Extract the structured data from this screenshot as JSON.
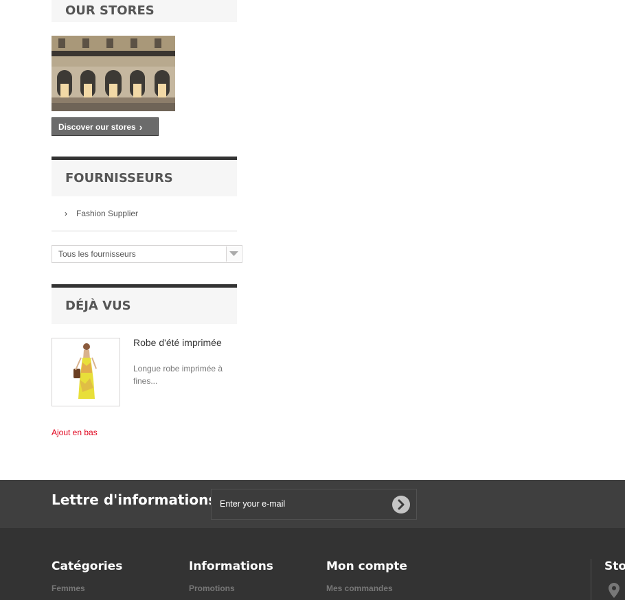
{
  "sidebar": {
    "stores": {
      "title": "OUR STORES",
      "button_label": "Discover our stores"
    },
    "suppliers": {
      "title": "FOURNISSEURS",
      "items": [
        {
          "label": "Fashion Supplier"
        }
      ],
      "select_value": "Tous les fournisseurs"
    },
    "viewed": {
      "title": "DÉJÀ VUS",
      "product_name": "Robe d'été imprimée",
      "product_desc": "Longue robe imprimée à fines..."
    },
    "add_bottom_link": "Ajout en bas"
  },
  "newsletter": {
    "title": "Lettre d'informations",
    "placeholder": "Enter your e-mail"
  },
  "footer": {
    "columns": [
      {
        "heading": "Catégories",
        "first_link": "Femmes"
      },
      {
        "heading": "Informations",
        "first_link": "Promotions"
      },
      {
        "heading": "Mon compte",
        "first_link": "Mes commandes"
      }
    ],
    "store_heading": "Sto"
  },
  "colors": {
    "accent_red": "#e0001a",
    "footer_bg": "#333333",
    "newsletter_bg": "#3f3f3f"
  }
}
